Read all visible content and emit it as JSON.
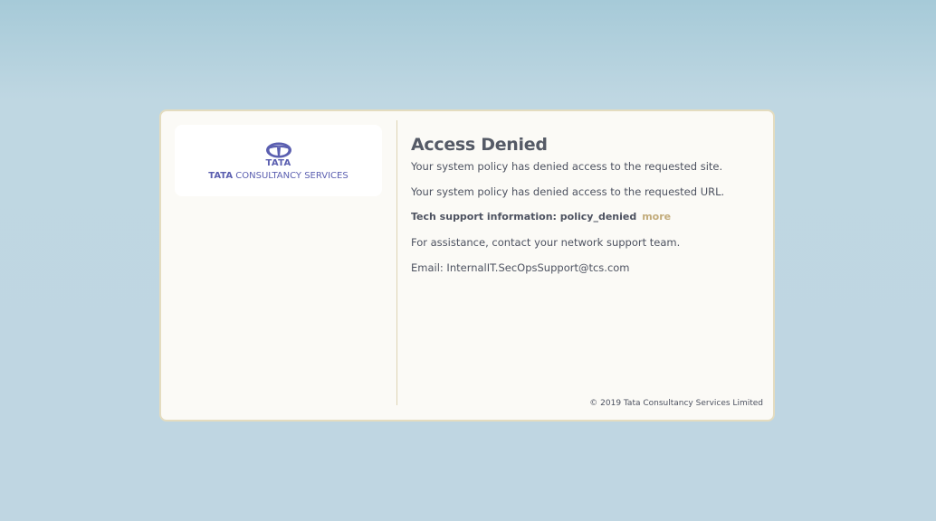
{
  "logo": {
    "icon": "tata-logo-icon",
    "wordmark": "TATA",
    "fullname_prefix": "TATA",
    "fullname_rest": " CONSULTANCY SERVICES",
    "brand_color": "#5b5fb0"
  },
  "main": {
    "title": "Access Denied",
    "line1": "Your system policy has denied access to the requested site.",
    "line2": "Your system policy has denied access to the requested URL.",
    "tech_label": "Tech support information: ",
    "tech_value": "policy_denied",
    "more_link": "more",
    "assistance": "For assistance, contact your network support team.",
    "email": "Email: InternalIT.SecOpsSupport@tcs.com"
  },
  "footer": {
    "copyright": "© 2019 Tata Consultancy Services Limited"
  },
  "colors": {
    "background": "#bfd7e2",
    "card": "#fbfaf6",
    "border": "#e4dcbf",
    "link": "#c2ab7a"
  }
}
